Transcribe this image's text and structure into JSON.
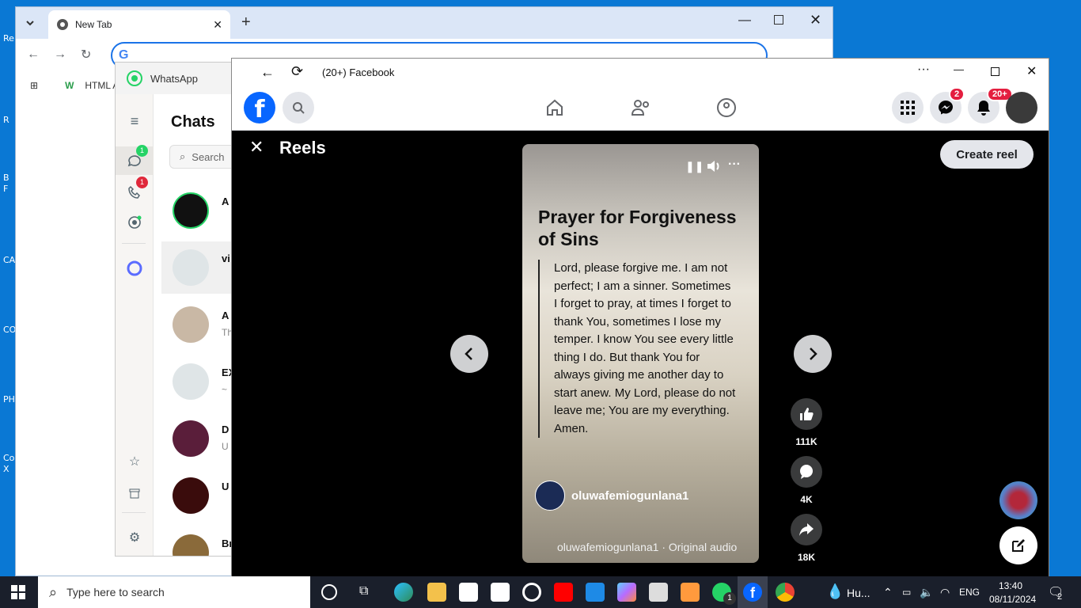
{
  "desktop": {
    "icon_labels": [
      "Re",
      "R",
      "B",
      "F",
      "CA",
      "CO",
      "PH",
      "Co",
      "X"
    ]
  },
  "chrome": {
    "tab_title": "New Tab",
    "bookmark_label": "HTML A"
  },
  "whatsapp": {
    "window_title": "WhatsApp",
    "chats_title": "Chats",
    "search_placeholder": "Search",
    "chats_badge": "1",
    "calls_badge": "1",
    "chats": [
      {
        "name": "A",
        "sub": ""
      },
      {
        "name": "vi",
        "sub": ""
      },
      {
        "name": "A",
        "sub": "Th"
      },
      {
        "name": "EX",
        "sub": "~"
      },
      {
        "name": "D",
        "sub": "U"
      },
      {
        "name": "U",
        "sub": ""
      },
      {
        "name": "Br",
        "sub": ""
      }
    ]
  },
  "facebook": {
    "window_title": "(20+) Facebook",
    "messenger_badge": "2",
    "notifications_badge": "20+",
    "reels_title": "Reels",
    "create_reel_label": "Create reel",
    "reel": {
      "title": "Prayer for Forgiveness of Sins",
      "body": "Lord, please forgive me. I am not perfect; I am a sinner. Sometimes I forget to pray, at times I forget to thank You, sometimes I lose my temper. I know You see every little thing I do. But thank You for always giving me another day to start anew. My Lord, please do not leave me; You are my everything. Amen.",
      "author": "oluwafemiogunlana1",
      "audio": "oluwafemiogunlana1 · Original audio"
    },
    "actions": {
      "likes": "111K",
      "comments": "4K",
      "shares": "18K"
    },
    "colors": {
      "brand": "#0866ff",
      "badge": "#e41e3f"
    }
  },
  "taskbar": {
    "search_placeholder": "Type here to search",
    "weather": "Hu...",
    "language": "ENG",
    "time": "13:40",
    "date": "08/11/2024",
    "whatsapp_badge": "1",
    "notification_count": "2"
  }
}
